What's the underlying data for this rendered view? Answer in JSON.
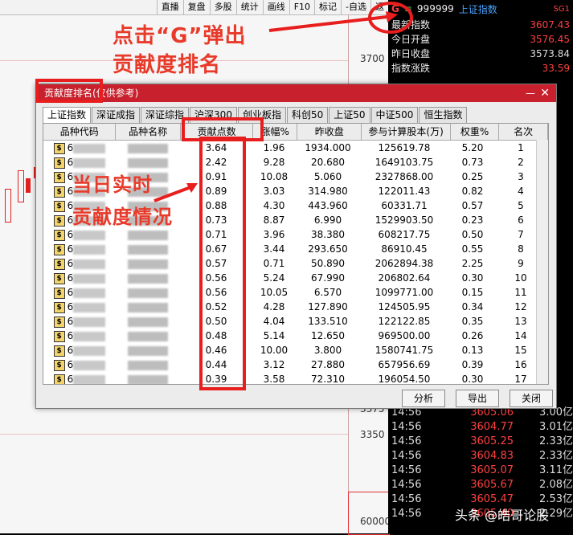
{
  "toolbar": {
    "items": [
      "直播",
      "复盘",
      "多股",
      "统计",
      "画线",
      "F10",
      "标记",
      "-自选",
      "返"
    ]
  },
  "quote": {
    "code": "999999",
    "name": "上证指数",
    "tag": "SG1",
    "rows": [
      {
        "label": "最新指数",
        "value": "3607.43"
      },
      {
        "label": "今日开盘",
        "value": "3576.45"
      },
      {
        "label": "昨日收盘",
        "value": "3573.84"
      },
      {
        "label": "指数涨跌",
        "value": "33.59"
      }
    ]
  },
  "price_axis": [
    "3700",
    "3375",
    "3350",
    "60000"
  ],
  "ticks": [
    {
      "t": "14:56",
      "p": "3605.06",
      "a": "3.00亿"
    },
    {
      "t": "14:56",
      "p": "3604.77",
      "a": "3.01亿"
    },
    {
      "t": "14:56",
      "p": "3605.25",
      "a": "2.33亿"
    },
    {
      "t": "14:56",
      "p": "3604.83",
      "a": "2.33亿"
    },
    {
      "t": "14:56",
      "p": "3605.07",
      "a": "3.11亿"
    },
    {
      "t": "14:56",
      "p": "3605.67",
      "a": "2.08亿"
    },
    {
      "t": "14:56",
      "p": "3605.47",
      "a": "2.53亿"
    },
    {
      "t": "14:56",
      "p": "3605.40",
      "a": "2.29亿"
    }
  ],
  "annotations": {
    "top": "点击“G”弹出",
    "top2": "贡献度排名",
    "middle1": "当日实时",
    "middle2": "贡献度情况"
  },
  "dialog": {
    "title": "贡献度排名(仅供参考)",
    "tabs": [
      "上证指数",
      "深证成指",
      "深证综指",
      "沪深300",
      "创业板指",
      "科创50",
      "上证50",
      "中证500",
      "恒生指数"
    ],
    "headers": [
      "品种代码",
      "品种名称",
      "贡献点数",
      "涨幅%",
      "昨收盘",
      "参与计算股本(万)",
      "权重%",
      "名次"
    ],
    "rows": [
      {
        "code": "6",
        "c": "3.64",
        "z": "1.96",
        "y": "1934.000",
        "g": "125619.78",
        "w": "5.20",
        "r": "1"
      },
      {
        "code": "6",
        "c": "2.42",
        "z": "9.28",
        "y": "20.680",
        "g": "1649103.75",
        "w": "0.73",
        "r": "2"
      },
      {
        "code": "6",
        "c": "0.91",
        "z": "10.08",
        "y": "5.060",
        "g": "2327868.00",
        "w": "0.25",
        "r": "3"
      },
      {
        "code": "6",
        "c": "0.89",
        "z": "3.03",
        "y": "314.980",
        "g": "122011.43",
        "w": "0.82",
        "r": "4"
      },
      {
        "code": "6",
        "c": "0.88",
        "z": "4.30",
        "y": "443.960",
        "g": "60331.71",
        "w": "0.57",
        "r": "5"
      },
      {
        "code": "6",
        "c": "0.73",
        "z": "8.87",
        "y": "6.990",
        "g": "1529903.50",
        "w": "0.23",
        "r": "6"
      },
      {
        "code": "6",
        "c": "0.71",
        "z": "3.96",
        "y": "38.380",
        "g": "608217.75",
        "w": "0.50",
        "r": "7"
      },
      {
        "code": "6",
        "c": "0.67",
        "z": "3.44",
        "y": "293.650",
        "g": "86910.45",
        "w": "0.55",
        "r": "8"
      },
      {
        "code": "6",
        "c": "0.57",
        "z": "0.71",
        "y": "50.890",
        "g": "2062894.38",
        "w": "2.25",
        "r": "9"
      },
      {
        "code": "6",
        "c": "0.56",
        "z": "5.24",
        "y": "67.990",
        "g": "206802.64",
        "w": "0.30",
        "r": "10"
      },
      {
        "code": "6",
        "c": "0.56",
        "z": "10.05",
        "y": "6.570",
        "g": "1099771.00",
        "w": "0.15",
        "r": "11"
      },
      {
        "code": "6",
        "c": "0.52",
        "z": "4.28",
        "y": "127.890",
        "g": "124505.95",
        "w": "0.34",
        "r": "12"
      },
      {
        "code": "6",
        "c": "0.50",
        "z": "4.04",
        "y": "133.510",
        "g": "122122.85",
        "w": "0.35",
        "r": "13"
      },
      {
        "code": "6",
        "c": "0.48",
        "z": "5.14",
        "y": "12.650",
        "g": "969500.00",
        "w": "0.26",
        "r": "14"
      },
      {
        "code": "6",
        "c": "0.46",
        "z": "10.00",
        "y": "3.800",
        "g": "1580741.75",
        "w": "0.13",
        "r": "15"
      },
      {
        "code": "6",
        "c": "0.44",
        "z": "3.12",
        "y": "27.880",
        "g": "657956.69",
        "w": "0.39",
        "r": "16"
      },
      {
        "code": "6",
        "c": "0.39",
        "z": "3.58",
        "y": "72.310",
        "g": "196054.50",
        "w": "0.30",
        "r": "17"
      }
    ],
    "buttons": [
      "分析",
      "导出",
      "关闭"
    ]
  },
  "watermark": "头条 @皓哥论股"
}
